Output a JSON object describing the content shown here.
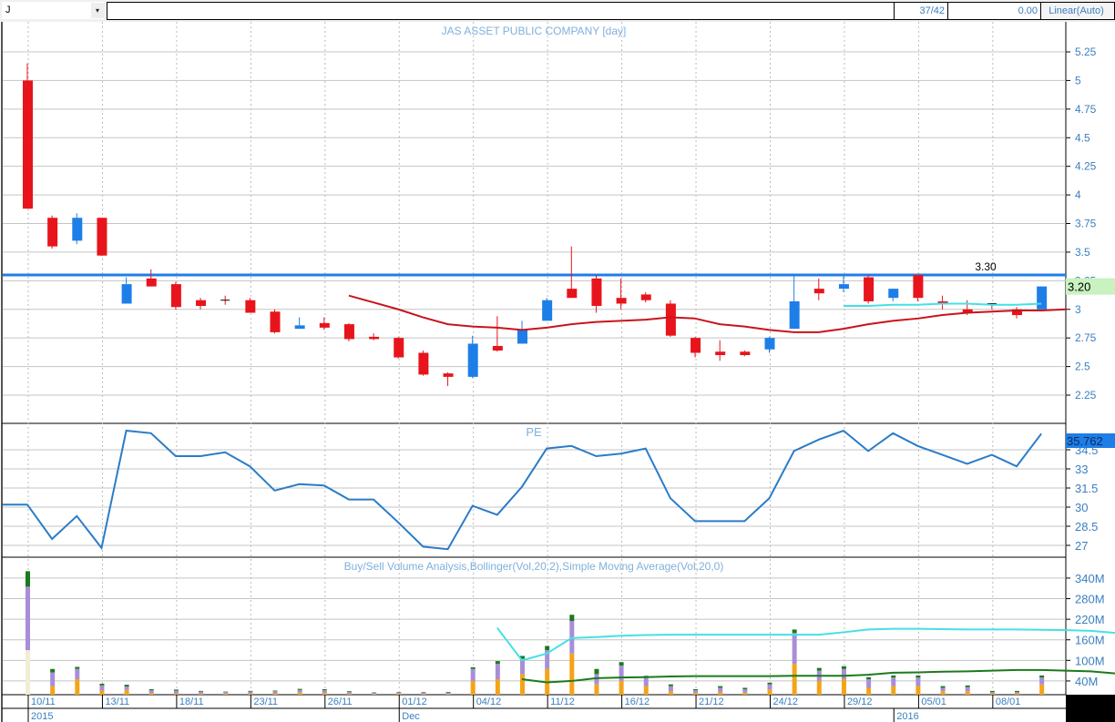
{
  "toolbar": {
    "symbol": "J",
    "dropdown_icon": "▾",
    "search_value": "",
    "position": "37/42",
    "value": "0.00",
    "scale": "Linear(Auto)"
  },
  "colors": {
    "up": "#1e7ee8",
    "down": "#e8141c",
    "ma": "#c8141c",
    "resistance": "#1e7ee8",
    "cyan": "#44e0e6",
    "pe": "#2a7cc8",
    "buy": "#f4a418",
    "sell": "#a88ed8",
    "other": "#1c7a1c",
    "first_base": "#f2ecd2",
    "sma": "#1c7a1c"
  },
  "price_panel": {
    "title": "JAS ASSET PUBLIC COMPANY [day]",
    "ticks": [
      "5.25",
      "5",
      "4.75",
      "4.5",
      "4.25",
      "4",
      "3.75",
      "3.5",
      "3.25",
      "3",
      "2.75",
      "2.5",
      "2.25"
    ],
    "resistance_value": 3.3,
    "resistance_label": "3.30",
    "last_price_label": "3.20",
    "candles": [
      [
        5.0,
        3.88,
        5.15,
        3.88
      ],
      [
        3.8,
        3.55,
        3.82,
        3.53
      ],
      [
        3.6,
        3.8,
        3.84,
        3.57
      ],
      [
        3.8,
        3.47,
        3.8,
        3.47
      ],
      [
        3.05,
        3.22,
        3.28,
        3.05
      ],
      [
        3.27,
        3.2,
        3.35,
        3.2
      ],
      [
        3.22,
        3.02,
        3.24,
        3.0
      ],
      [
        3.08,
        3.03,
        3.1,
        3.0
      ],
      [
        3.08,
        3.08,
        3.12,
        3.04
      ],
      [
        3.08,
        2.97,
        3.1,
        2.97
      ],
      [
        2.98,
        2.8,
        3.0,
        2.79
      ],
      [
        2.83,
        2.86,
        2.93,
        2.83
      ],
      [
        2.88,
        2.84,
        2.93,
        2.82
      ],
      [
        2.87,
        2.74,
        2.88,
        2.72
      ],
      [
        2.76,
        2.74,
        2.79,
        2.73
      ],
      [
        2.75,
        2.58,
        2.76,
        2.57
      ],
      [
        2.62,
        2.43,
        2.64,
        2.42
      ],
      [
        2.44,
        2.41,
        2.45,
        2.33
      ],
      [
        2.41,
        2.7,
        2.77,
        2.4
      ],
      [
        2.68,
        2.64,
        2.94,
        2.63
      ],
      [
        2.7,
        2.82,
        2.9,
        2.7
      ],
      [
        2.9,
        3.08,
        3.1,
        2.9
      ],
      [
        3.18,
        3.1,
        3.55,
        3.1
      ],
      [
        3.27,
        3.03,
        3.3,
        2.97
      ],
      [
        3.1,
        3.05,
        3.27,
        3.0
      ],
      [
        3.13,
        3.08,
        3.15,
        3.06
      ],
      [
        3.05,
        2.77,
        3.08,
        2.76
      ],
      [
        2.75,
        2.62,
        2.76,
        2.58
      ],
      [
        2.63,
        2.6,
        2.73,
        2.55
      ],
      [
        2.63,
        2.6,
        2.64,
        2.59
      ],
      [
        2.65,
        2.75,
        2.76,
        2.62
      ],
      [
        2.83,
        3.07,
        3.3,
        2.83
      ],
      [
        3.18,
        3.14,
        3.27,
        3.08
      ],
      [
        3.18,
        3.22,
        3.3,
        3.15
      ],
      [
        3.28,
        3.07,
        3.3,
        3.05
      ],
      [
        3.1,
        3.18,
        3.18,
        3.07
      ],
      [
        3.3,
        3.1,
        3.3,
        3.07
      ],
      [
        3.07,
        3.05,
        3.12,
        3.0
      ],
      [
        3.0,
        2.97,
        3.08,
        2.95
      ],
      [
        3.05,
        3.05,
        3.05,
        3.0
      ],
      [
        3.0,
        2.95,
        3.02,
        2.92
      ],
      [
        3.0,
        3.2,
        3.2,
        3.0
      ]
    ],
    "ma_start_index": 13,
    "ma": [
      3.12,
      3.06,
      3.0,
      2.93,
      2.87,
      2.85,
      2.84,
      2.82,
      2.84,
      2.87,
      2.89,
      2.9,
      2.91,
      2.93,
      2.92,
      2.87,
      2.85,
      2.82,
      2.8,
      2.8,
      2.83,
      2.87,
      2.9,
      2.92,
      2.95,
      2.97,
      2.98,
      2.99,
      2.99,
      3.0
    ],
    "cyan_start_index": 33,
    "cyan": [
      3.03,
      3.03,
      3.04,
      3.04,
      3.05,
      3.05,
      3.04,
      3.04,
      3.05
    ]
  },
  "pe_panel": {
    "title": "PE",
    "ticks": [
      "34.5",
      "33",
      "31.5",
      "30",
      "28.5",
      "27"
    ],
    "last_label": "35.762",
    "values": [
      30.2,
      27.5,
      29.3,
      26.8,
      36.0,
      35.8,
      34.0,
      34.0,
      34.3,
      33.2,
      31.3,
      31.8,
      31.7,
      30.6,
      30.6,
      28.8,
      26.9,
      26.7,
      30.1,
      29.4,
      31.6,
      34.6,
      34.8,
      34.0,
      34.2,
      34.6,
      30.7,
      28.9,
      28.9,
      28.9,
      30.7,
      34.4,
      35.3,
      36.0,
      34.4,
      35.8,
      34.8,
      34.1,
      33.4,
      34.1,
      33.2,
      35.762
    ]
  },
  "volume_panel": {
    "title": "Buy/Sell Volume Analysis,Bollinger(Vol,20,2),Simple Moving Average(Vol,20,0)",
    "ticks": [
      "340M",
      "280M",
      "220M",
      "160M",
      "100M",
      "40M"
    ],
    "bars": [
      [
        130,
        185,
        45
      ],
      [
        25,
        40,
        10
      ],
      [
        45,
        30,
        6
      ],
      [
        12,
        15,
        5
      ],
      [
        14,
        10,
        5
      ],
      [
        5,
        8,
        3
      ],
      [
        4,
        8,
        3
      ],
      [
        3,
        6,
        2
      ],
      [
        3,
        5,
        1
      ],
      [
        3,
        6,
        2
      ],
      [
        4,
        6,
        2
      ],
      [
        6,
        8,
        3
      ],
      [
        5,
        8,
        3
      ],
      [
        3,
        5,
        2
      ],
      [
        2,
        4,
        1
      ],
      [
        3,
        4,
        1
      ],
      [
        2,
        5,
        1
      ],
      [
        2,
        4,
        2
      ],
      [
        40,
        35,
        5
      ],
      [
        45,
        45,
        8
      ],
      [
        60,
        45,
        8
      ],
      [
        75,
        55,
        12
      ],
      [
        120,
        95,
        18
      ],
      [
        30,
        30,
        15
      ],
      [
        40,
        45,
        10
      ],
      [
        25,
        25,
        5
      ],
      [
        10,
        15,
        5
      ],
      [
        5,
        8,
        3
      ],
      [
        8,
        12,
        5
      ],
      [
        6,
        10,
        4
      ],
      [
        15,
        15,
        5
      ],
      [
        90,
        90,
        10
      ],
      [
        40,
        30,
        8
      ],
      [
        45,
        30,
        8
      ],
      [
        20,
        25,
        6
      ],
      [
        25,
        25,
        6
      ],
      [
        25,
        25,
        6
      ],
      [
        10,
        10,
        5
      ],
      [
        10,
        12,
        5
      ],
      [
        4,
        4,
        3
      ],
      [
        4,
        4,
        3
      ],
      [
        30,
        20,
        6
      ]
    ],
    "bollinger_start_index": 19,
    "bollinger": [
      195,
      100,
      120,
      165,
      168,
      172,
      174,
      175,
      175,
      175,
      175,
      175,
      175,
      175,
      182,
      190,
      192,
      192,
      191,
      190,
      190,
      190,
      189,
      188,
      186,
      180,
      170
    ],
    "sma_start_index": 20,
    "sma": [
      45,
      36,
      40,
      48,
      50,
      51,
      53,
      54,
      54,
      54,
      54,
      55,
      55,
      55,
      58,
      64,
      65,
      67,
      68,
      70,
      72,
      72,
      70,
      68,
      62,
      56
    ]
  },
  "date_axis": {
    "labels": [
      [
        "10/11",
        0
      ],
      [
        "13/11",
        3
      ],
      [
        "18/11",
        6
      ],
      [
        "23/11",
        9
      ],
      [
        "26/11",
        12
      ],
      [
        "01/12",
        15
      ],
      [
        "04/12",
        18
      ],
      [
        "11/12",
        21
      ],
      [
        "16/12",
        24
      ],
      [
        "21/12",
        27
      ],
      [
        "24/12",
        30
      ],
      [
        "29/12",
        33
      ],
      [
        "05/01",
        36
      ],
      [
        "08/01",
        39
      ]
    ],
    "years": [
      [
        "2015",
        0
      ],
      [
        "Dec",
        15
      ],
      [
        "2016",
        35
      ]
    ]
  }
}
